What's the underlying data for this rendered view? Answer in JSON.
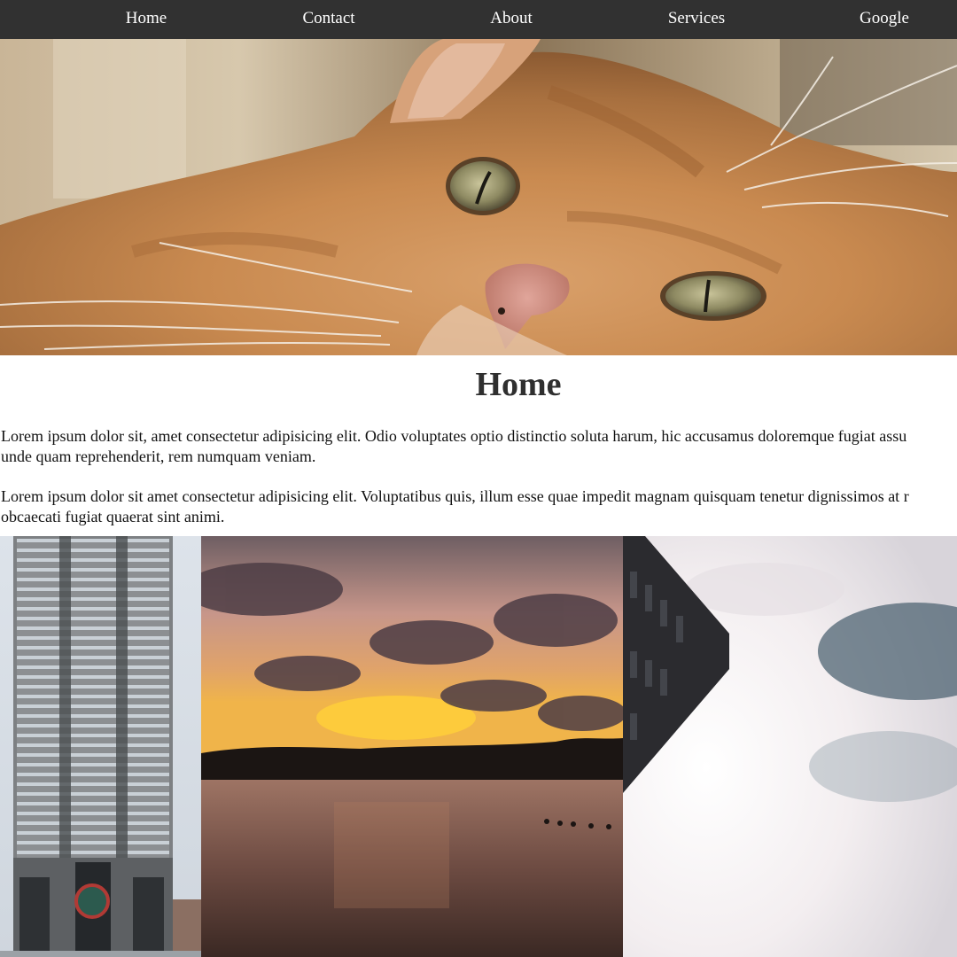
{
  "nav": {
    "items": [
      {
        "label": "Home"
      },
      {
        "label": "Contact"
      },
      {
        "label": "About"
      },
      {
        "label": "Services"
      },
      {
        "label": "Google"
      }
    ]
  },
  "hero": {
    "image": "cat-photo"
  },
  "main": {
    "title": "Home",
    "paragraphs": [
      {
        "line1": "Lorem ipsum dolor sit, amet consectetur adipisicing elit. Odio voluptates optio distinctio soluta harum, hic accusamus doloremque fugiat assu",
        "line2": "unde quam reprehenderit, rem numquam veniam."
      },
      {
        "line1": "Lorem ipsum dolor sit amet consectetur adipisicing elit. Voluptatibus quis, illum esse quae impedit magnam quisquam tenetur dignissimos at r",
        "line2": "obcaecati fugiat quaerat sint animi."
      }
    ]
  },
  "gallery": {
    "images": [
      "building-photo",
      "sunset-lake-photo",
      "corner-building-sky-photo"
    ]
  },
  "colors": {
    "nav_bg": "#313131",
    "nav_text": "#ffffff",
    "title": "#2f2f2f"
  }
}
